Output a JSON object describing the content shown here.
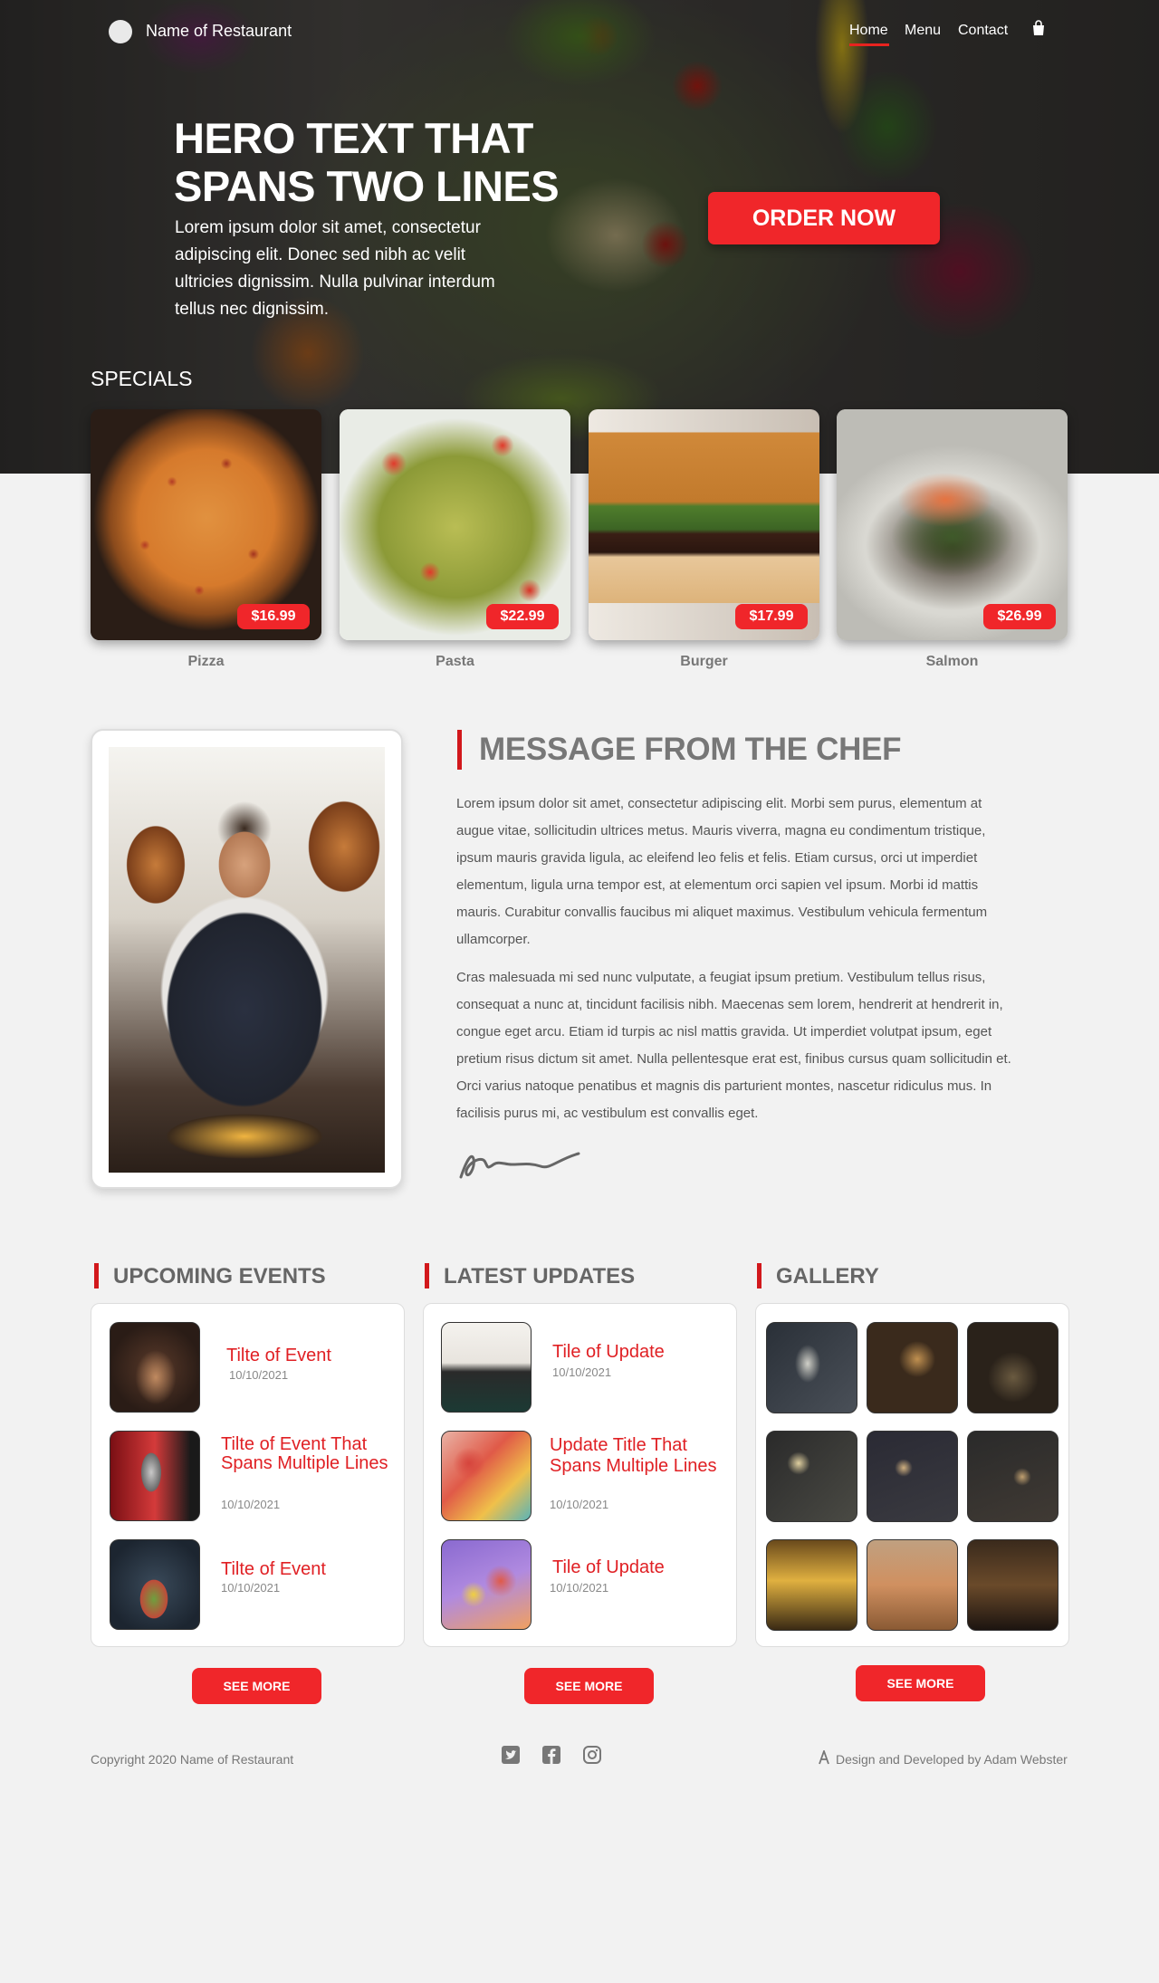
{
  "nav": {
    "brand_name": "Name of Restaurant",
    "links": [
      {
        "label": "Home",
        "active": true
      },
      {
        "label": "Menu",
        "active": false
      },
      {
        "label": "Contact",
        "active": false
      }
    ],
    "cart_icon": "shopping-bag-icon"
  },
  "hero": {
    "title": "HERO TEXT THAT SPANS TWO LINES",
    "body": "Lorem ipsum dolor sit amet, consectetur adipiscing elit. Donec sed nibh ac velit ultricies dignissim. Nulla pulvinar interdum tellus nec dignissim.",
    "cta_label": "ORDER NOW"
  },
  "specials": {
    "heading": "SPECIALS",
    "items": [
      {
        "name": "Pizza",
        "price": "$16.99"
      },
      {
        "name": "Pasta",
        "price": "$22.99"
      },
      {
        "name": "Burger",
        "price": "$17.99"
      },
      {
        "name": "Salmon",
        "price": "$26.99"
      }
    ]
  },
  "chef": {
    "title": "MESSAGE FROM THE CHEF",
    "paragraphs": [
      "Lorem ipsum dolor sit amet, consectetur adipiscing elit. Morbi sem purus, elementum at augue vitae, sollicitudin ultrices metus. Mauris viverra, magna eu condimentum tristique, ipsum mauris gravida ligula, ac eleifend leo felis et felis. Etiam cursus, orci ut imperdiet elementum, ligula urna tempor est, at elementum orci sapien vel ipsum. Morbi id mattis mauris. Curabitur convallis faucibus mi aliquet maximus. Vestibulum vehicula fermentum ullamcorper.",
      "Cras malesuada mi sed nunc vulputate, a feugiat ipsum pretium. Vestibulum tellus risus, consequat a nunc at, tincidunt facilisis nibh. Maecenas sem lorem, hendrerit at hendrerit in, congue eget arcu. Etiam id turpis ac nisl mattis gravida. Ut imperdiet volutpat ipsum, eget pretium risus dictum sit amet. Nulla pellentesque erat est, finibus cursus quam sollicitudin et. Orci varius natoque penatibus et magnis dis parturient montes, nascetur ridiculus mus. In facilisis purus mi, ac vestibulum est convallis eget."
    ]
  },
  "events": {
    "heading": "UPCOMING EVENTS",
    "items": [
      {
        "title": "Tilte of Event",
        "date": "10/10/2021"
      },
      {
        "title": "Tilte of Event That Spans Multiple Lines",
        "date": "10/10/2021"
      },
      {
        "title": "Tilte of Event",
        "date": "10/10/2021"
      }
    ],
    "see_more": "SEE MORE"
  },
  "updates": {
    "heading": "LATEST UPDATES",
    "items": [
      {
        "title": "Tile of Update",
        "date": "10/10/2021"
      },
      {
        "title": "Update Title That Spans Multiple Lines",
        "date": "10/10/2021"
      },
      {
        "title": "Tile of Update",
        "date": "10/10/2021"
      }
    ],
    "see_more": "SEE MORE"
  },
  "gallery": {
    "heading": "GALLERY",
    "see_more": "SEE MORE"
  },
  "footer": {
    "copyright": "Copyright 2020 Name of Restaurant",
    "social_icons": [
      "twitter-icon",
      "facebook-icon",
      "instagram-icon"
    ],
    "credit": "Design and Developed by Adam Webster"
  },
  "colors": {
    "accent": "#f0262a",
    "heading_bar": "#d2181c",
    "page_bg": "#f2f2f2"
  }
}
